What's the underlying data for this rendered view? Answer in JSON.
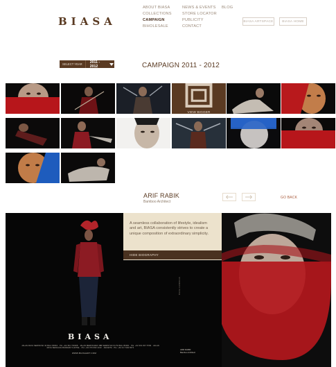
{
  "header": {
    "logo": "BIASA",
    "nav_col1": [
      "ABOUT BIASA",
      "COLLECTIONS",
      "CAMPAIGN",
      "BIHOLESALE"
    ],
    "nav_col2": [
      "NEWS & EVENTS",
      "STORE LOCATOR",
      "PUBLICITY",
      "CONTACT"
    ],
    "nav_col3": [
      "BLOG"
    ],
    "active_item": "CAMPAIGN",
    "buttons": [
      "BIASA ARTSPACE",
      "BIASA HOME"
    ]
  },
  "year_select": {
    "label": "SELECT YEAR",
    "value": "2011 - 2012"
  },
  "page_title": "CAMPAIGN 2011 - 2012",
  "view_bigger_label": "VIEW BIGGER",
  "person": {
    "name": "ARIF RABIK",
    "role": "Bamboo Architect"
  },
  "go_back_label": "GO BACK",
  "bio": {
    "text": "A seamless collaboration of lifestyle, idealism and art, BIASA consistently strives to create a unique composition of extraordinary simplicity.",
    "hide_label": "HIDE BIOGRAPHY"
  },
  "big_image": {
    "logo": "BIASA",
    "address": "JALAN RAYA SEMINYAK 34 BALI 80361 · PH. +62 361 730308 · JALAN MERTANADI 38B SEMINYAK KUTA BALI 80361 · PH. +62 361 847 5766 · JALAN RAYA SENGGIGI BANDAR 5 HOTEL · PH. +62 370 693 1313 · JAKARTA · PH. +62 21 7192 6571",
    "website": "WWW.BIASAART.COM",
    "vertical_label": "BIASA CAMPAIGN",
    "caption": [
      "ARIF RABIK",
      "Bamboo Architect"
    ]
  },
  "colors": {
    "brand_brown": "#5a3a22",
    "accent_red": "#b8191c",
    "link_red": "#a8593a",
    "bio_bg": "#ece2cc"
  }
}
